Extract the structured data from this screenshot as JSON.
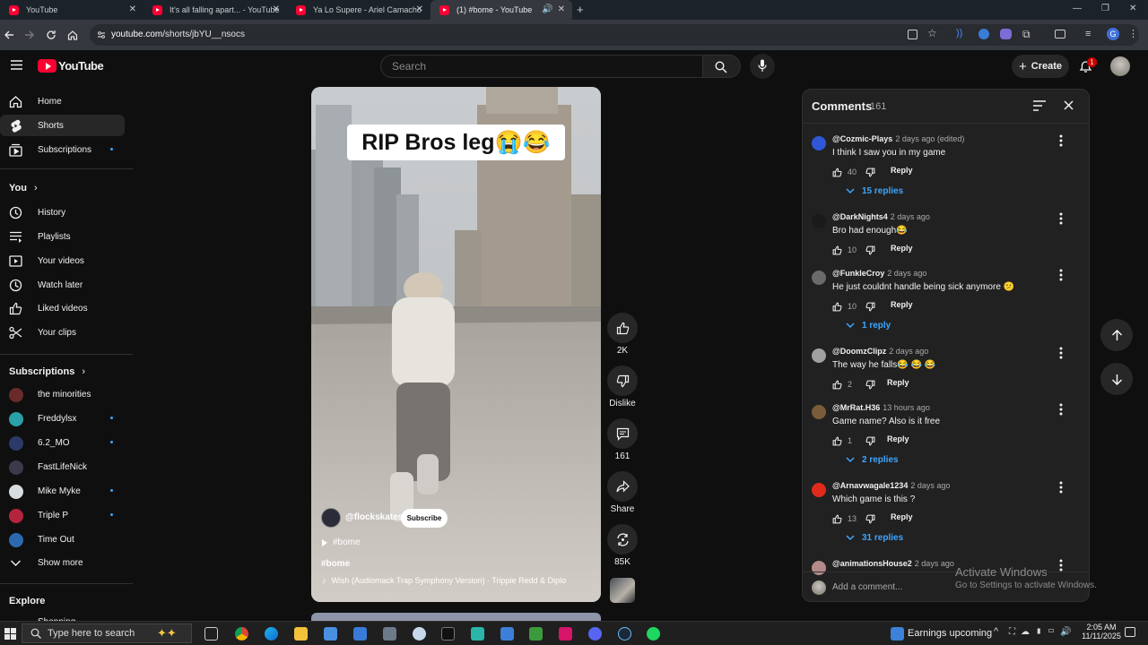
{
  "browser": {
    "tabs": [
      {
        "title": "YouTube"
      },
      {
        "title": "It's all falling apart... - YouTube"
      },
      {
        "title": "Ya Lo Supere - Ariel Camacho"
      },
      {
        "title": "(1) #bome - YouTube",
        "active": true
      }
    ],
    "url_domain": "youtube.com",
    "url_path": "/shorts/jbYU__nsocs"
  },
  "header": {
    "logo": "YouTube",
    "search_placeholder": "Search",
    "create_label": "Create",
    "notification_count": "1"
  },
  "sidebar": {
    "main": [
      {
        "label": "Home",
        "icon": "home-icon"
      },
      {
        "label": "Shorts",
        "icon": "shorts-icon",
        "active": true
      },
      {
        "label": "Subscriptions",
        "icon": "subscriptions-icon"
      }
    ],
    "you_heading": "You",
    "you_items": [
      {
        "label": "History",
        "icon": "history-icon"
      },
      {
        "label": "Playlists",
        "icon": "playlists-icon"
      },
      {
        "label": "Your videos",
        "icon": "your-videos-icon"
      },
      {
        "label": "Watch later",
        "icon": "watch-later-icon"
      },
      {
        "label": "Liked videos",
        "icon": "liked-videos-icon"
      },
      {
        "label": "Your clips",
        "icon": "clips-icon"
      }
    ],
    "subs_heading": "Subscriptions",
    "subscriptions": [
      {
        "label": "the minorities",
        "color": "#6a2a2a"
      },
      {
        "label": "Freddylsx",
        "color": "#2aa0a8"
      },
      {
        "label": "6.2_MO",
        "color": "#2b3a68"
      },
      {
        "label": "FastLifeNick",
        "color": "#3a3a4a"
      },
      {
        "label": "Mike Myke",
        "color": "#d8dbe0"
      },
      {
        "label": "Triple P",
        "color": "#b4243c"
      },
      {
        "label": "Time Out",
        "color": "#2b6ab0"
      }
    ],
    "show_more": "Show more",
    "explore_heading": "Explore",
    "explore_first": "Shopping"
  },
  "video": {
    "caption": "RIP Bros leg😭😂",
    "channel": "@flockskates",
    "subscribe": "Subscribe",
    "playlist_tag": "#bome",
    "hashtag": "#bome",
    "music": "Wish (Audiomack Trap Symphony Version) · Trippie Redd & Diplo"
  },
  "actions": {
    "likes": "2K",
    "dislike": "Dislike",
    "comments": "161",
    "share": "Share",
    "remix": "85K"
  },
  "comments": {
    "title": "Comments",
    "count": "161",
    "reply_label": "Reply",
    "add_placeholder": "Add a comment...",
    "items": [
      {
        "author": "@Cozmic-Plays",
        "time": "2 days ago (edited)",
        "text": "I think I saw you in my game",
        "likes": "40",
        "replies": "15 replies",
        "color": "#2f57d6"
      },
      {
        "author": "@DarkNights4",
        "time": "2 days ago",
        "text": "Bro had enough😂",
        "likes": "10",
        "replies": "",
        "color": "#1a1a1a"
      },
      {
        "author": "@FunkleCroy",
        "time": "2 days ago",
        "text": "He just couldnt handle being sick anymore 😕",
        "likes": "10",
        "replies": "1 reply",
        "color": "#6a6a6a"
      },
      {
        "author": "@DoomzClipz",
        "time": "2 days ago",
        "text": "The way he falls😂 😂 😂",
        "likes": "2",
        "replies": "",
        "color": "#a0a0a0"
      },
      {
        "author": "@MrRat.H36",
        "time": "13 hours ago",
        "text": "Game name? Also is it free",
        "likes": "1",
        "replies": "2 replies",
        "color": "#7a5c3a"
      },
      {
        "author": "@Arnavwagale1234",
        "time": "2 days ago",
        "text": "Which game is this ?",
        "likes": "13",
        "replies": "31 replies",
        "color": "#e02a1c"
      },
      {
        "author": "@animationsHouse2",
        "time": "2 days ago",
        "text": "",
        "likes": "",
        "replies": "",
        "color": "#b38a8a"
      }
    ]
  },
  "watermark": {
    "title": "Activate Windows",
    "subtitle": "Go to Settings to activate Windows."
  },
  "taskbar": {
    "search_placeholder": "Type here to search",
    "weather": "Earnings upcoming",
    "time": "2:05 AM",
    "date": "11/11/2025"
  }
}
